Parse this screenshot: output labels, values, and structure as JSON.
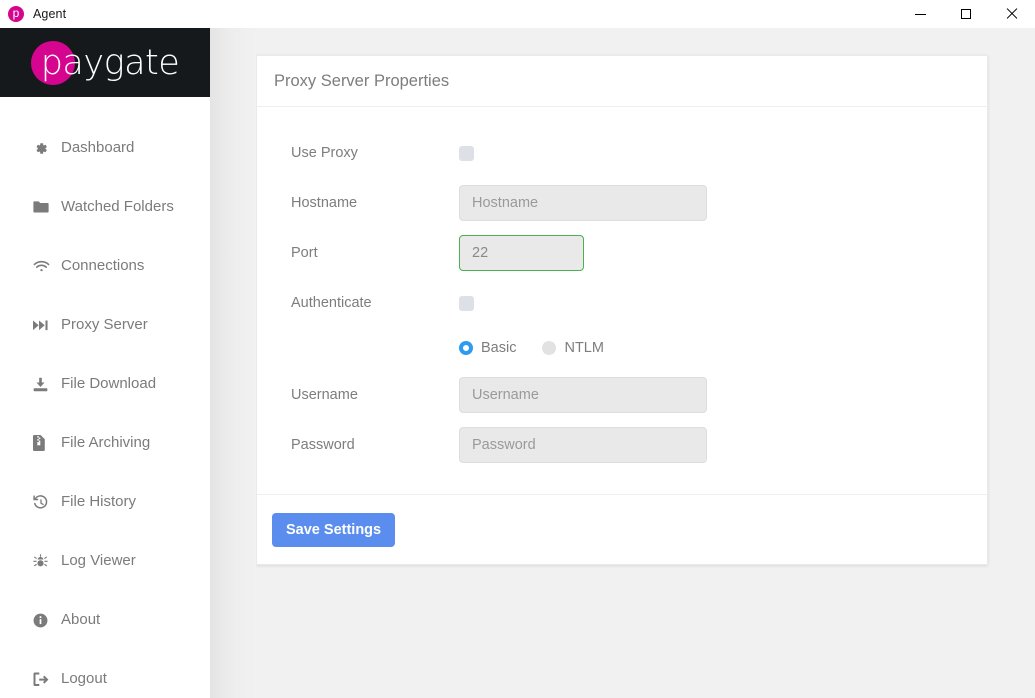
{
  "window": {
    "title": "Agent",
    "icon": "paygate-logo-icon",
    "controls": {
      "minimize": "minimize-icon",
      "maximize": "maximize-icon",
      "close": "close-icon"
    }
  },
  "brand": {
    "logo_text": "paygate",
    "logo_color": "#d6058f",
    "logo_bg": "#16191c"
  },
  "sidebar": {
    "items": [
      {
        "label": "Dashboard",
        "icon": "gear-icon"
      },
      {
        "label": "Watched Folders",
        "icon": "folder-icon"
      },
      {
        "label": "Connections",
        "icon": "wifi-icon"
      },
      {
        "label": "Proxy Server",
        "icon": "step-forward-icon"
      },
      {
        "label": "File Download",
        "icon": "download-icon"
      },
      {
        "label": "File Archiving",
        "icon": "file-archive-icon"
      },
      {
        "label": "File History",
        "icon": "history-icon"
      },
      {
        "label": "Log Viewer",
        "icon": "bug-icon"
      },
      {
        "label": "About",
        "icon": "info-circle-icon"
      },
      {
        "label": "Logout",
        "icon": "sign-out-icon"
      }
    ]
  },
  "card": {
    "title": "Proxy Server Properties",
    "fields": {
      "use_proxy": {
        "label": "Use Proxy",
        "checked": false
      },
      "hostname": {
        "label": "Hostname",
        "value": "",
        "placeholder": "Hostname"
      },
      "port": {
        "label": "Port",
        "value": "22",
        "placeholder": "22",
        "border_color": "#4caf50"
      },
      "authenticate": {
        "label": "Authenticate",
        "checked": false
      },
      "username": {
        "label": "Username",
        "value": "",
        "placeholder": "Username"
      },
      "password": {
        "label": "Password",
        "value": "",
        "placeholder": "Password"
      }
    },
    "auth_mode": {
      "selected": "Basic",
      "options": [
        {
          "label": "Basic",
          "selected": true
        },
        {
          "label": "NTLM",
          "selected": false
        }
      ],
      "selected_color": "#2d9cf0"
    },
    "save_label": "Save Settings",
    "save_color": "#5a8dee"
  }
}
